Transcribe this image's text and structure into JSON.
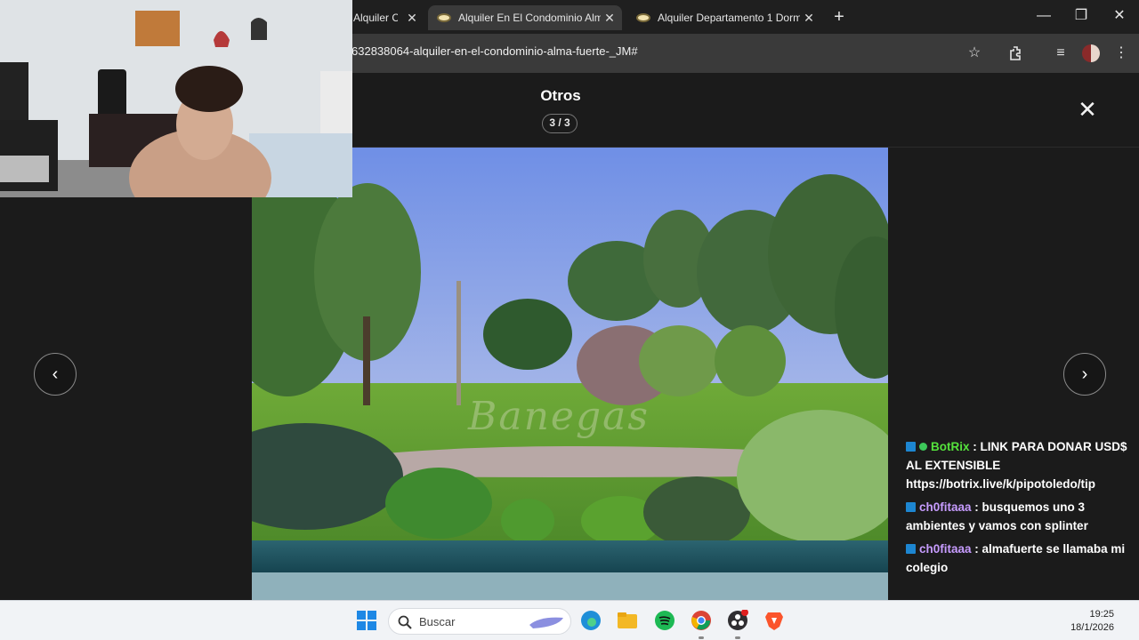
{
  "browser": {
    "tabs": [
      {
        "title": "Alquiler C",
        "active": false
      },
      {
        "title": "Alquiler En El Condominio Alma",
        "active": true
      },
      {
        "title": "Alquiler Departamento 1 Dorm",
        "active": false
      }
    ],
    "url": "632838064-alquiler-en-el-condominio-alma-fuerte-_JM#"
  },
  "gallery": {
    "title": "Otros",
    "counter": "3 / 3",
    "watermark": "Banegas"
  },
  "chat": {
    "messages": [
      {
        "user": "BotRix",
        "text": " : LINK PARA DONAR USD$ AL EXTENSIBLE https://botrix.live/k/pipotoledo/tip",
        "user_color": "#55e23c",
        "verified": true
      },
      {
        "user": "ch0fitaaa",
        "text": " : busquemos uno 3 ambientes y vamos con splinter",
        "user_color": "#c79cff",
        "verified": false
      },
      {
        "user": "ch0fitaaa",
        "text": " : almafuerte se llamaba mi colegio",
        "user_color": "#c79cff",
        "verified": false
      }
    ]
  },
  "taskbar": {
    "search_placeholder": "Buscar",
    "time": "19:25",
    "date": "18/1/2026"
  },
  "icons": {
    "prev": "chevron-left-icon",
    "next": "chevron-right-icon",
    "close": "close-icon"
  }
}
